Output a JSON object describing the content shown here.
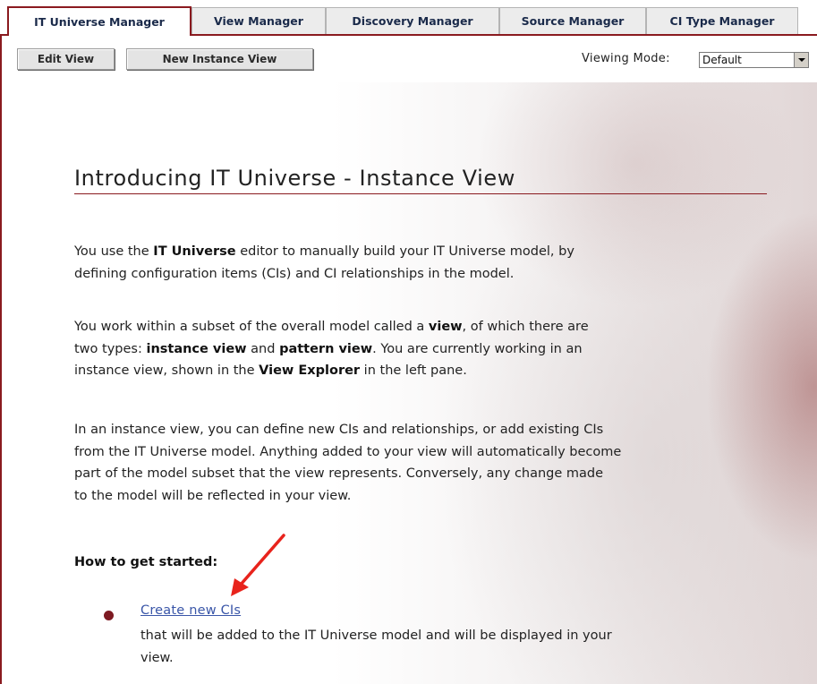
{
  "tabs": [
    {
      "label": "IT Universe Manager",
      "active": true
    },
    {
      "label": "View Manager",
      "active": false
    },
    {
      "label": "Discovery Manager",
      "active": false
    },
    {
      "label": "Source Manager",
      "active": false
    },
    {
      "label": "CI Type Manager",
      "active": false
    }
  ],
  "toolbar": {
    "edit_view_label": "Edit View",
    "new_instance_view_label": "New Instance View",
    "viewing_mode_label": "Viewing Mode:",
    "viewing_mode_value": "Default"
  },
  "content": {
    "title": "Introducing IT Universe - Instance View",
    "para1": {
      "line1_pre": "You use the ",
      "line1_bold": "IT Universe",
      "line1_post": " editor to manually build your IT Universe model, by",
      "line2": "defining configuration items (CIs) and CI relationships in the model."
    },
    "para2": {
      "line1_pre": "You work within a subset of the overall model called a ",
      "line1_bold": "view",
      "line1_post": ", of which there are",
      "line2_pre": "two types: ",
      "line2_bold1": "instance view",
      "line2_mid": " and ",
      "line2_bold2": "pattern view",
      "line2_post": ". You are currently working in an",
      "line3_pre": "instance view, shown in the ",
      "line3_bold": "View Explorer",
      "line3_post": " in the left pane."
    },
    "para3": {
      "line1": "In an instance view, you can define new CIs and relationships, or add existing CIs",
      "line2": "from the IT Universe model. Anything added to your view will automatically become",
      "line3": "part of the model subset that the view represents. Conversely, any change made",
      "line4": "to the model will be reflected in your view."
    },
    "how_to_heading": "How to get started:",
    "steps": [
      {
        "link": "Create new CIs",
        "desc_line1": "that will be added to the IT Universe model and will be displayed in your",
        "desc_line2": "view."
      }
    ]
  },
  "colors": {
    "accent": "#8a1a1f",
    "link": "#3a56a8",
    "bullet": "#7d1a22",
    "annotation_arrow": "#e8231c"
  }
}
